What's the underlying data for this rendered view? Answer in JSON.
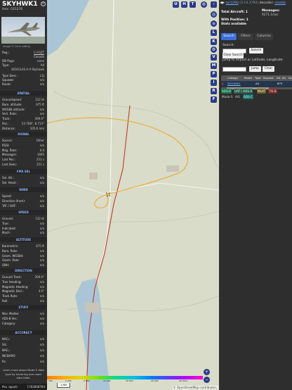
{
  "left_panel": {
    "callsign": "SKYHWK1",
    "hex_label": "Hex:",
    "hex_value": "C61276",
    "photo_credit": "Image © Chris Lofting",
    "reg_label": "Reg.:",
    "reg_value": "C-FGZT",
    "country": "Canada",
    "db_flags_label": "DB flags:",
    "db_flags_value": "none",
    "type_label": "Type:",
    "type_value": "A4",
    "type_name": "DOUGLAS A-4 Skyhawk",
    "type_desc_label": "Type Desc.:",
    "type_desc_value": "L1J",
    "squawk_label": "Squawk:",
    "squawk_value": "n/a",
    "route_label": "Route:",
    "route_value": "n/a",
    "sections": {
      "spatial": "SPATIAL",
      "signal": "SIGNAL",
      "fms": "FMS SEL",
      "wind": "WIND",
      "speed": "SPEED",
      "altitude": "ALTITUDE",
      "direction": "DIRECTION",
      "stuff": "STUFF",
      "accuracy": "ACCURACY"
    },
    "spatial_rows": [
      {
        "label": "Groundspeed:",
        "value": "132 kt"
      },
      {
        "label": "Baro. altitude:",
        "value": "675 ft"
      },
      {
        "label": "WGS84 altitude:",
        "value": "n/a"
      },
      {
        "label": "Vert. Rate:",
        "value": "n/a"
      },
      {
        "label": "Track:",
        "value": "309.0°"
      },
      {
        "label": "Pos.:",
        "value": "53.768°, 8.713°"
      },
      {
        "label": "Distance:",
        "value": "105.6 nmi"
      }
    ],
    "signal_rows": [
      {
        "label": "Source:",
        "value": "Other"
      },
      {
        "label": "RSSI:",
        "value": "n/a"
      },
      {
        "label": "Msg. Rate:",
        "value": "0.0"
      },
      {
        "label": "Messages:",
        "value": "1695"
      },
      {
        "label": "Last Pos.:",
        "value": "251 s"
      },
      {
        "label": "Last Seen:",
        "value": "251 s"
      }
    ],
    "fms_rows": [
      {
        "label": "Sel. Alt.:",
        "value": "n/a"
      },
      {
        "label": "Sel. Head.:",
        "value": "n/a"
      }
    ],
    "wind_rows": [
      {
        "label": "Speed:",
        "value": "n/a"
      },
      {
        "label": "Direction (from):",
        "value": "n/a"
      },
      {
        "label": "TAT / OAT:",
        "value": "n/a"
      }
    ],
    "speed_rows": [
      {
        "label": "Ground:",
        "value": "132 kt"
      },
      {
        "label": "True:",
        "value": "n/a"
      },
      {
        "label": "Indicated:",
        "value": "n/a"
      },
      {
        "label": "Mach:",
        "value": "n/a"
      }
    ],
    "altitude_rows": [
      {
        "label": "Barometric:",
        "value": "675 ft"
      },
      {
        "label": "Baro. Rate:",
        "value": "n/a"
      },
      {
        "label": "Geom. WGS84:",
        "value": "n/a"
      },
      {
        "label": "Geom. Rate:",
        "value": "n/a"
      },
      {
        "label": "QNH:",
        "value": "n/a"
      }
    ],
    "direction_rows": [
      {
        "label": "Ground Track:",
        "value": "309.0°"
      },
      {
        "label": "True Heading:",
        "value": "n/a"
      },
      {
        "label": "Magnetic Heading:",
        "value": "n/a"
      },
      {
        "label": "Magnetic Decl.:",
        "value": "4.0°"
      },
      {
        "label": "Track Rate:",
        "value": "n/a"
      },
      {
        "label": "Roll:",
        "value": "n/a"
      }
    ],
    "stuff_rows": [
      {
        "label": "Nav. Modes:",
        "value": "n/a"
      },
      {
        "label": "ADS-B Ver.:",
        "value": "n/a"
      },
      {
        "label": "Category:",
        "value": "n/a"
      }
    ],
    "accuracy_rows": [
      {
        "label": "NACₚ:",
        "value": "n/a"
      },
      {
        "label": "SIL:",
        "value": "n/a"
      },
      {
        "label": "NACᵥ:",
        "value": "n/a"
      },
      {
        "label": "NICBARO:",
        "value": "n/a"
      },
      {
        "label": "Rc:",
        "value": "n/a"
      }
    ],
    "footer_text": "Learn more about Mode S data type by hovering over each data label.",
    "epoch_label": "Pos. epoch:",
    "epoch_value": "1763668794"
  },
  "map": {
    "top_buttons": [
      "U",
      "H",
      "T"
    ],
    "side_buttons": [
      "L",
      "K",
      "V",
      "M",
      "P",
      "I",
      "R",
      "F"
    ],
    "zoom_in": "+",
    "zoom_out": "−",
    "scale_label": "1 NM",
    "attribution": "© OpenStreetMap contributors.",
    "altitude_ticks": [
      "300",
      "2 000",
      "6 000",
      "10 000",
      "20 000",
      "30 000",
      "40 000+"
    ],
    "colors": {
      "track": "#f0a830",
      "route_red": "#c0392b",
      "water": "#aac6d6",
      "land": "#d8dcc8"
    }
  },
  "right_panel": {
    "title_link": "tar1090",
    "version": "(3.14.1792)",
    "decoder_label": "decoder:",
    "decoder_link": "readsb",
    "total_aircraft_label": "Total Aircraft: 1",
    "messages_label": "Messages:",
    "messages_rate": "9271.1/sec",
    "with_position": "With Position: 1",
    "stats_available": "Stats available",
    "tabs": [
      "Search",
      "Filters",
      "Columns"
    ],
    "search_label": "Search:",
    "search_button": "Search",
    "clear_search_button": "Clear Search",
    "jump_label": "Jump to Airport or Latitude, Longitude:",
    "jump_button": "Jump",
    "clear_button": "Clear",
    "table_headers": [
      "Callsign",
      "Route",
      "Type",
      "Squawk",
      "Alt. (ft)",
      "Sp"
    ],
    "table_row": {
      "callsign": "SKYHWK1",
      "type": "A4",
      "altitude": "675"
    },
    "source_legend": [
      "ADS-B",
      "UAT / ADS-R",
      "MLAT",
      "TIS-B",
      "Mode-S",
      "AIS",
      "ADS-C"
    ]
  }
}
